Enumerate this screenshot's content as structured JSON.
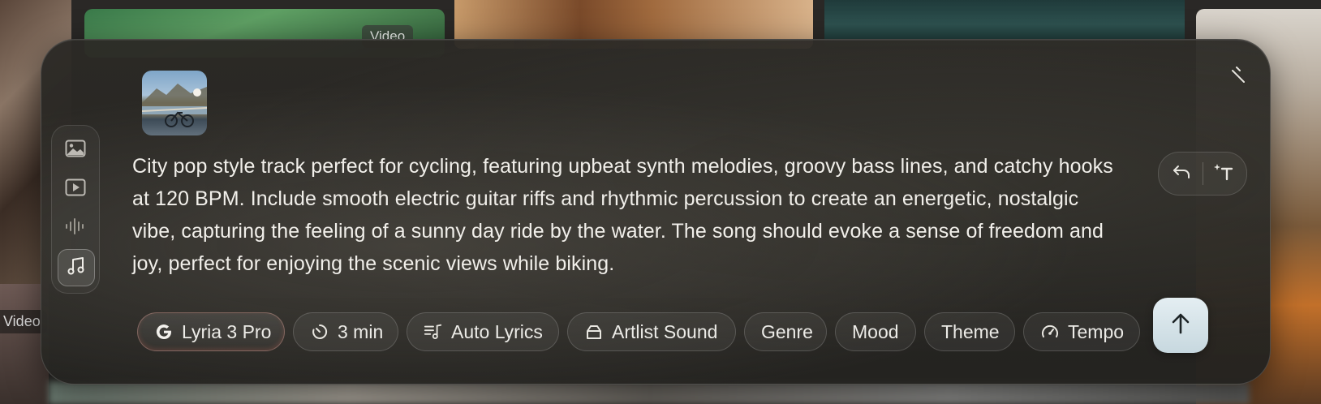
{
  "background": {
    "video_chip_top": "Video",
    "video_chip_left": "Video"
  },
  "composer": {
    "prompt": "City pop style track perfect for cycling, featuring upbeat synth melodies, groovy bass lines, and catchy hooks at 120 BPM. Include smooth electric guitar riffs and rhythmic percussion to create an energetic, nostalgic vibe, capturing the feeling of a sunny day ride by the water. The song should evoke a sense of freedom and joy, perfect for enjoying the scenic views while biking.",
    "modes": [
      {
        "name": "image",
        "icon": "image-icon",
        "active": false
      },
      {
        "name": "video",
        "icon": "play-icon",
        "active": false
      },
      {
        "name": "audio",
        "icon": "waveform-icon",
        "active": false
      },
      {
        "name": "music",
        "icon": "music-note-icon",
        "active": true
      }
    ],
    "chips": {
      "model": "Lyria 3 Pro",
      "duration": "3 min",
      "lyrics": "Auto Lyrics",
      "sound": "Artlist Sound",
      "genre": "Genre",
      "mood": "Mood",
      "theme": "Theme",
      "tempo": "Tempo"
    },
    "icons": {
      "model": "google-g-icon",
      "duration": "timer-icon",
      "lyrics": "lyrics-icon",
      "sound": "bag-icon",
      "tempo": "speedometer-icon",
      "send": "arrow-up-icon",
      "undo": "undo-icon",
      "enhance": "sparkle-text-icon",
      "collapse": "collapse-icon"
    },
    "colors": {
      "panel": "#2c2a26",
      "text": "#f1efea",
      "send_button": "#d6e4ea"
    }
  }
}
